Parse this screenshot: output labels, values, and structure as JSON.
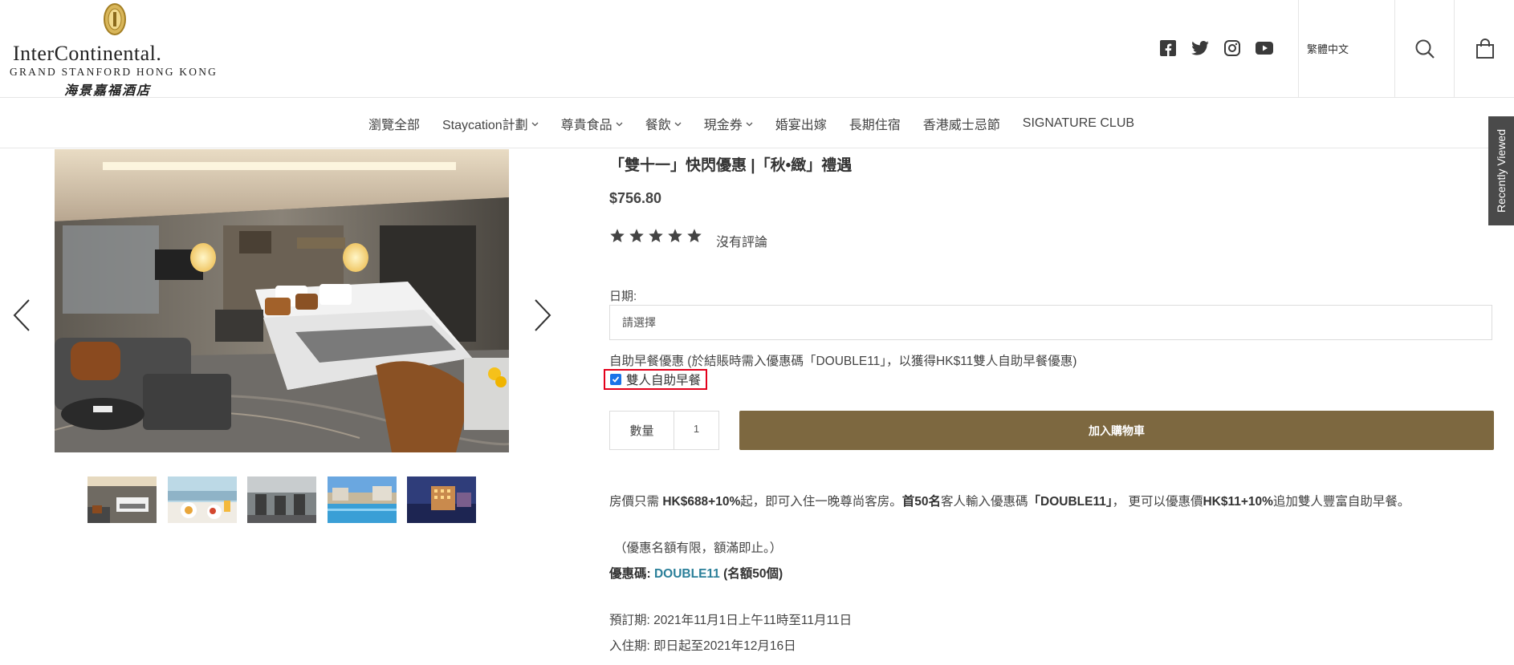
{
  "header": {
    "brand_name": "InterContinental.",
    "brand_sub": "GRAND STANFORD HONG KONG",
    "brand_cn": "海景嘉福酒店",
    "social_icons": [
      "facebook-icon",
      "twitter-icon",
      "instagram-icon",
      "youtube-icon"
    ],
    "language": "繁體中文",
    "search_icon": "search-icon",
    "cart_icon": "shopping-bag-icon"
  },
  "nav": {
    "items": [
      {
        "label": "瀏覽全部",
        "has_caret": false
      },
      {
        "label": "Staycation計劃",
        "has_caret": true
      },
      {
        "label": "尊貴食品",
        "has_caret": true
      },
      {
        "label": "餐飲",
        "has_caret": true
      },
      {
        "label": "現金券",
        "has_caret": true
      },
      {
        "label": "婚宴出嫁",
        "has_caret": false
      },
      {
        "label": "長期住宿",
        "has_caret": false
      },
      {
        "label": "香港威士忌節",
        "has_caret": false
      },
      {
        "label": "SIGNATURE CLUB",
        "has_caret": false
      }
    ]
  },
  "gallery": {
    "main_image": "hotel-bedroom-photo",
    "prev_icon": "chevron-left-icon",
    "next_icon": "chevron-right-icon",
    "thumbnails": [
      "bedroom-thumb",
      "breakfast-thumb",
      "gym-thumb",
      "pool-thumb",
      "hotel-night-thumb"
    ]
  },
  "product": {
    "title": "「雙十一」快閃優惠 |「秋•緻」禮遇",
    "price": "$756.80",
    "rating_stars": 5,
    "review_text": "沒有評論",
    "date_label": "日期:",
    "date_placeholder": "請選擇",
    "breakfast_label": "自助早餐優惠 (於結賬時需入優惠碼「DOUBLE11」，以獲得HK$11雙人自助早餐優惠)",
    "breakfast_option": "雙人自助早餐",
    "breakfast_checked": true,
    "qty_label": "數量",
    "qty_value": "1",
    "add_to_cart": "加入購物車"
  },
  "description": {
    "d1": "房價只需 ",
    "d2": "HK$688+10%",
    "d3": "起，即可入住一晚尊尚客房。",
    "d4": "首50名",
    "d5": "客人輸入優惠碼",
    "d6": "「DOUBLE11」",
    "d7": "，  更可以優惠價",
    "d8": "HK$11+10%",
    "d9": "追加雙人豐富自助早餐。",
    "note": "（優惠名額有限，額滿即止。）",
    "promo_label": "優惠碼: ",
    "promo_code": "DOUBLE11",
    "promo_quota": " (名額50個)",
    "booking_period": "預訂期:  2021年11月1日上午11時至11月11日",
    "checkin_period": "入住期:  即日起至2021年12月16日"
  },
  "sidebar": {
    "recently_viewed": "Recently Viewed"
  },
  "colors": {
    "accent": "#7d6840",
    "promo_code": "#2a7f99",
    "highlight_border": "#e3001b"
  }
}
